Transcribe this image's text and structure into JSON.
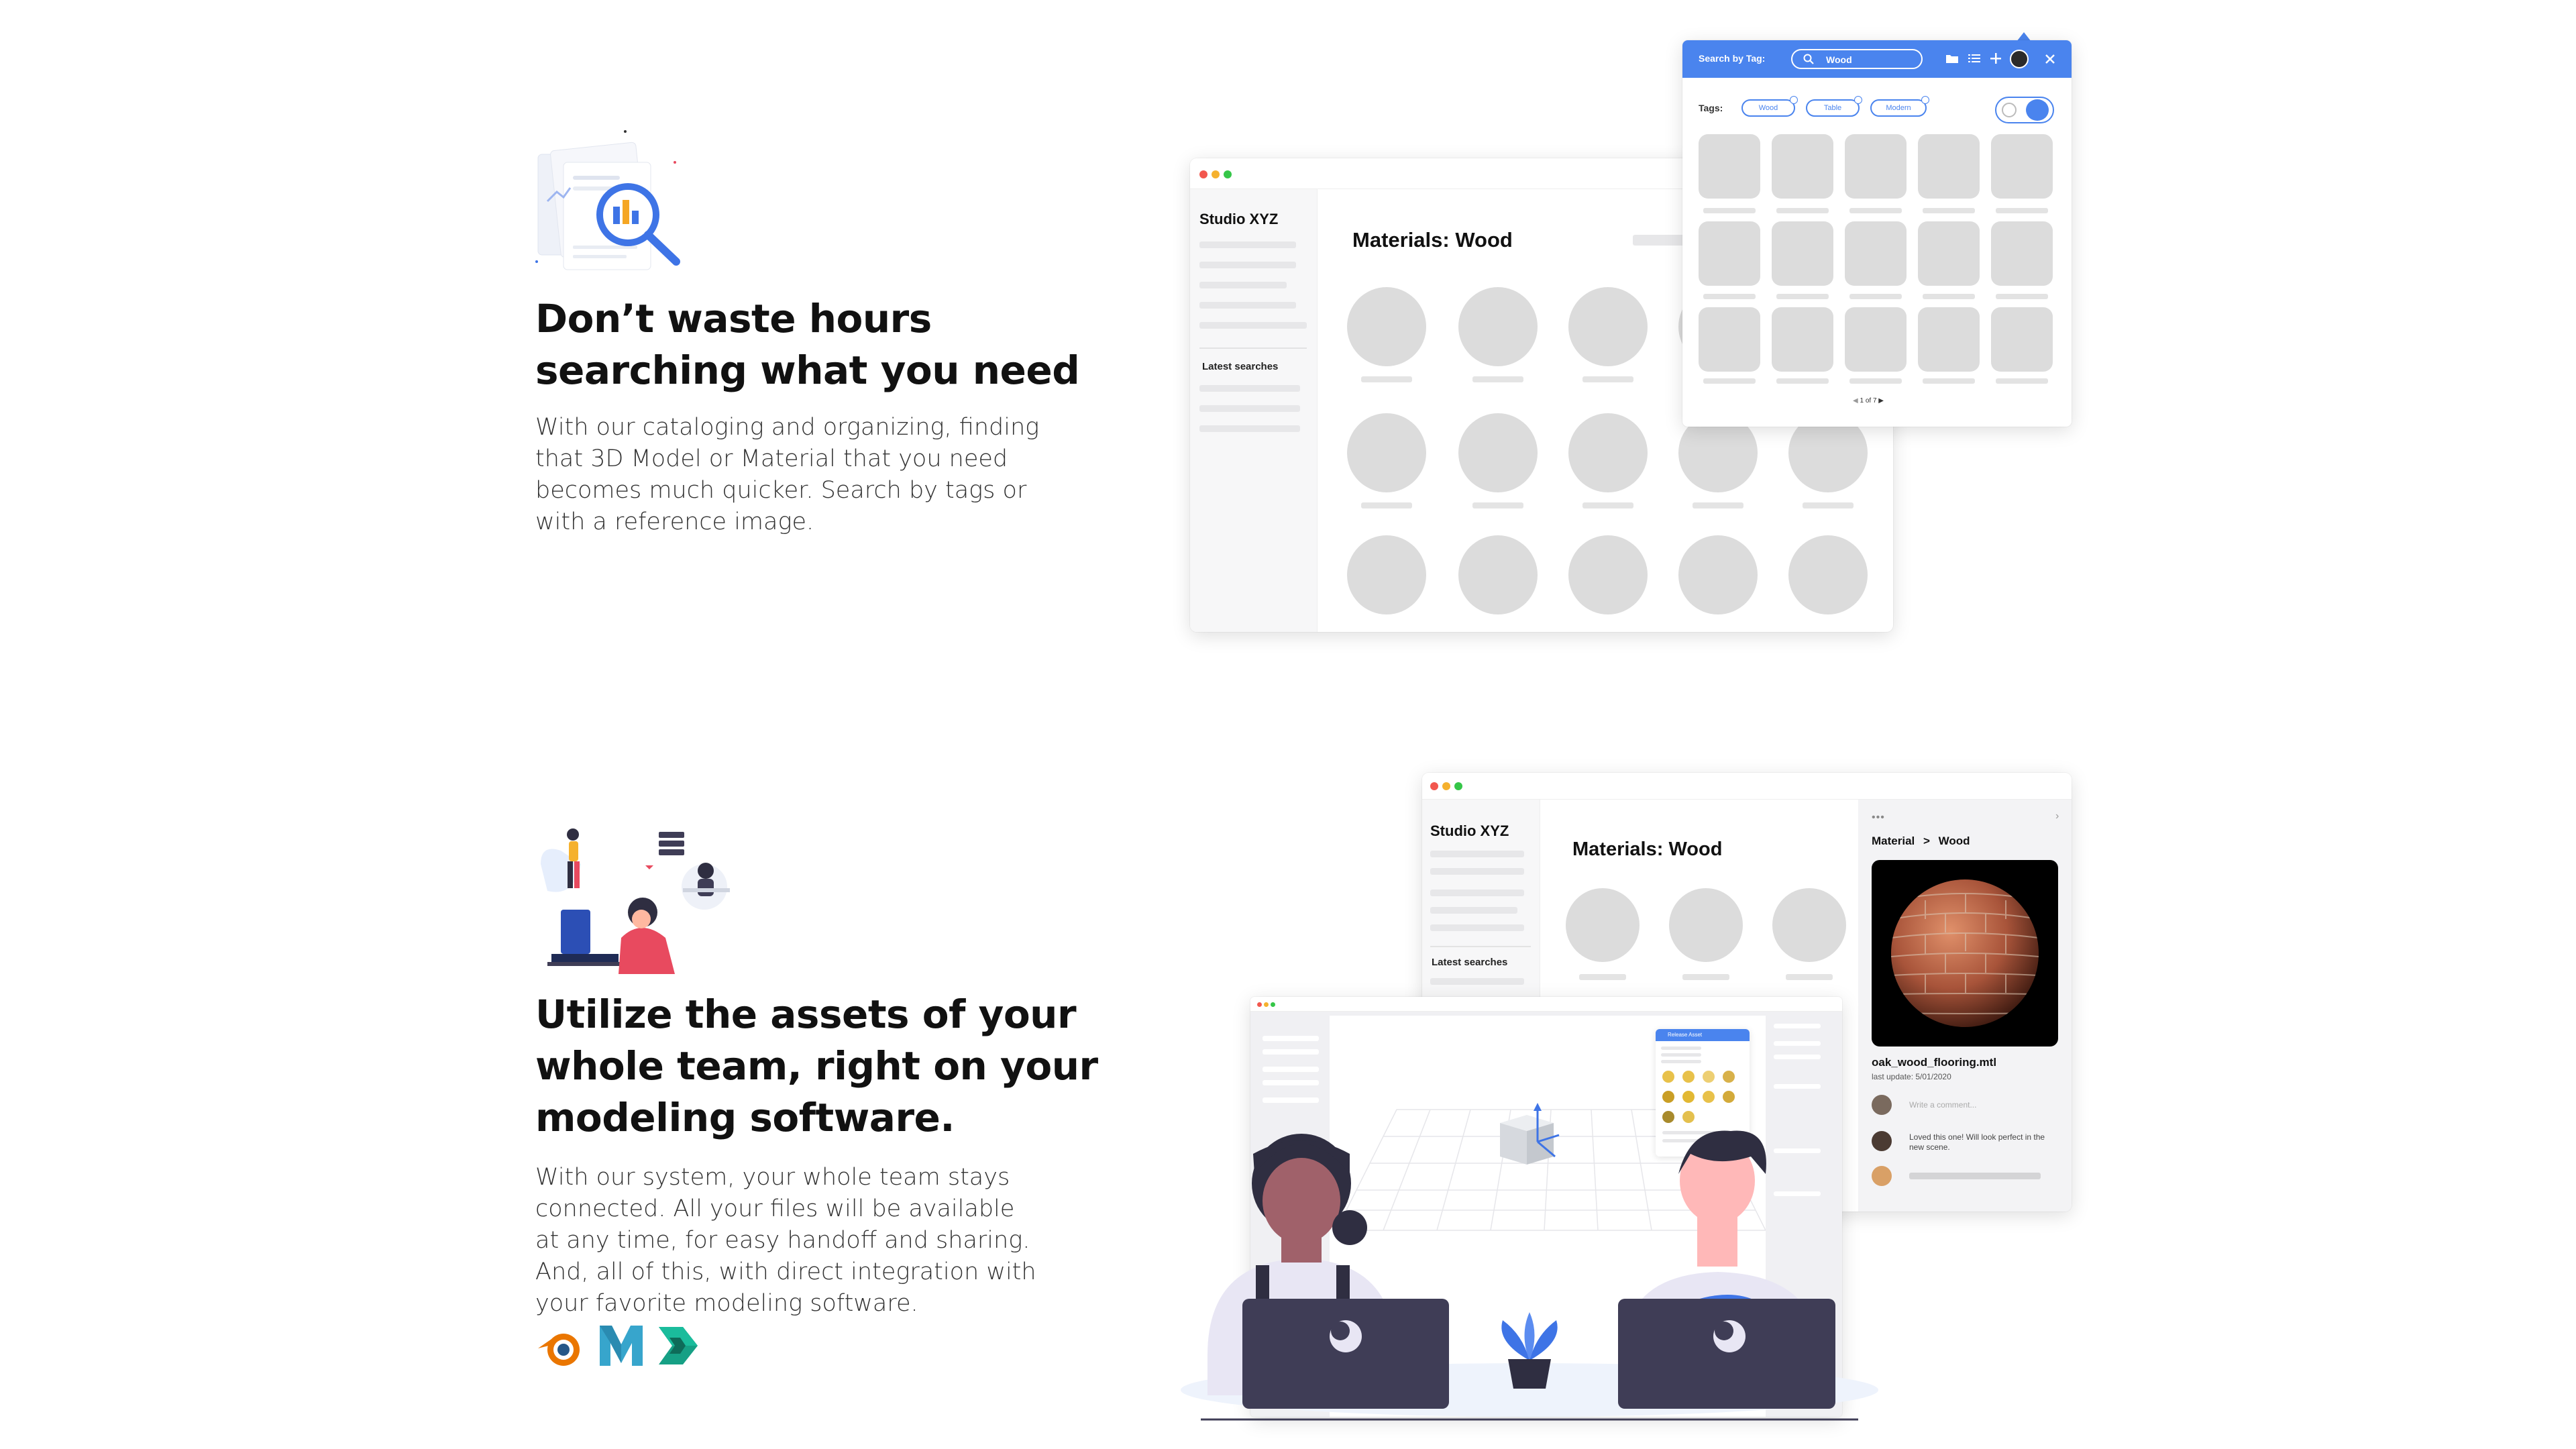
{
  "section1": {
    "heading_lines": [
      "Don’t waste hours",
      "searching what you need"
    ],
    "paragraph_lines": [
      "With our cataloging and organizing, finding",
      "that 3D Model or Material that you need",
      "becomes much quicker. Search by tags or",
      "with a reference image."
    ]
  },
  "section2": {
    "heading_lines": [
      "Utilize the assets of your",
      "whole team, right on your",
      "modeling software."
    ],
    "paragraph_lines": [
      "With our system, your whole team stays",
      "connected. All your files will be available",
      "at any time, for easy handoff and sharing.",
      "And, all of this, with direct integration with",
      "your favorite modeling software."
    ]
  },
  "app_window": {
    "sidebar_title": "Studio XYZ",
    "latest_searches_label": "Latest searches",
    "main_title": "Materials: Wood"
  },
  "search_popup": {
    "label": "Search by Tag:",
    "search_value": "Wood",
    "tags_label": "Tags:",
    "tags": [
      "Wood",
      "Table",
      "Modern"
    ],
    "pagination": "1 of 7"
  },
  "detail_window": {
    "sidebar_title": "Studio XYZ",
    "latest_searches_label": "Latest searches",
    "main_title": "Materials: Wood",
    "breadcrumb_root": "Material",
    "breadcrumb_sep": ">",
    "breadcrumb_leaf": "Wood",
    "file_name": "oak_wood_flooring.mtl",
    "last_update": "last update: 5/01/2020",
    "comment_placeholder": "Write a comment...",
    "comment_text": "Loved this one! Will look perfect in the new scene."
  },
  "plugin_panel": {
    "title": "Release Asset"
  },
  "software_icons": [
    "blender-icon",
    "maya-icon",
    "3ds-max-icon"
  ],
  "colors": {
    "accent": "#4a84ee",
    "placeholder_gray": "#dcdcdc",
    "heading": "#111111",
    "body_text": "#333333",
    "blender_orange": "#ea7600",
    "maya_teal": "#37a5cc",
    "max_teal": "#16a085"
  }
}
